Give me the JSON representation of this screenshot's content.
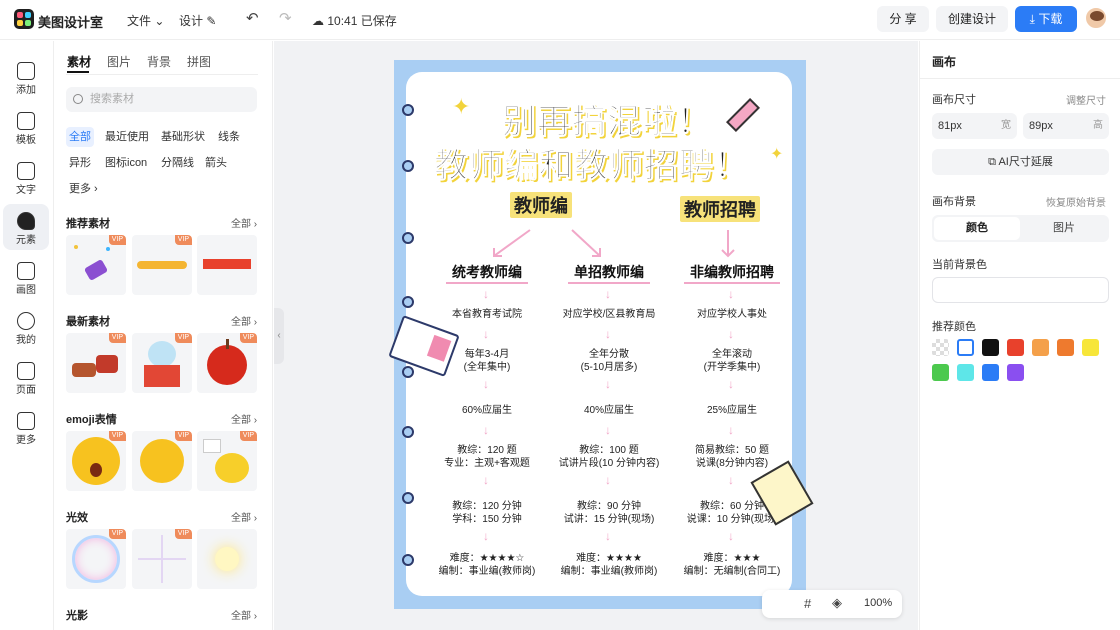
{
  "app": {
    "name": "美图设计室"
  },
  "topbar": {
    "file_menu": "文件",
    "design_menu": "设计",
    "save_status": "10:41 已保存",
    "share_label": "分 享",
    "create_label": "创建设计",
    "download_label": "下载"
  },
  "rail": [
    {
      "label": "添加",
      "icon": "plus-square-icon"
    },
    {
      "label": "模板",
      "icon": "template-icon"
    },
    {
      "label": "文字",
      "icon": "text-icon"
    },
    {
      "label": "元素",
      "icon": "shapes-icon",
      "active": true
    },
    {
      "label": "画图",
      "icon": "pencil-icon"
    },
    {
      "label": "我的",
      "icon": "user-icon"
    },
    {
      "label": "页面",
      "icon": "page-add-icon"
    },
    {
      "label": "更多",
      "icon": "cube-icon"
    }
  ],
  "panel": {
    "tabs": [
      "素材",
      "图片",
      "背景",
      "拼图"
    ],
    "search_placeholder": "搜索素材",
    "chips_row1": [
      "全部",
      "最近使用",
      "基础形状",
      "线条"
    ],
    "chips_row2": [
      "异形",
      "图标icon",
      "分隔线",
      "箭头"
    ],
    "more_label": "更多",
    "all_label": "全部",
    "vip_label": "VIP",
    "sections": [
      {
        "title": "推荐素材",
        "items": [
          "party-popper",
          "yellow-brush-stroke",
          "red-bar"
        ]
      },
      {
        "title": "最新素材",
        "items": [
          "reindeer-sleigh",
          "snow-globe-gift",
          "red-apple"
        ]
      },
      {
        "title": "emoji表情",
        "items": [
          "scared-face",
          "thinking-face",
          "chick-with-sign"
        ]
      },
      {
        "title": "光效",
        "items": [
          "rainbow-bubble",
          "sparkle-star",
          "glow"
        ]
      },
      {
        "title": "光影",
        "items": []
      }
    ]
  },
  "poster": {
    "title_line1": "别再搞混啦！",
    "title_line2": "教师编和教师招聘！",
    "tag_left": "教师编",
    "tag_right": "教师招聘",
    "columns": [
      {
        "head": "统考教师编",
        "rows": [
          "本省教育考试院",
          "每年3-4月\n(全年集中)",
          "60%应届生",
          "教综：120 题\n专业：主观+客观题",
          "教综：120 分钟\n学科：150 分钟",
          "难度：★★★★☆\n编制：事业编(教师岗)"
        ]
      },
      {
        "head": "单招教师编",
        "rows": [
          "对应学校/区县教育局",
          "全年分散\n(5-10月居多)",
          "40%应届生",
          "教综：100 题\n试讲片段(10 分钟内容)",
          "教综：90 分钟\n试讲：15 分钟(现场)",
          "难度：★★★★\n编制：事业编(教师岗)"
        ]
      },
      {
        "head": "非编教师招聘",
        "rows": [
          "对应学校人事处",
          "全年滚动\n(开学季集中)",
          "25%应届生",
          "简易教综：50 题\n说课(8分钟内容)",
          "教综：60 分钟\n说课：10 分钟(现场)",
          "难度：★★★\n编制：无编制(合同工)"
        ]
      }
    ]
  },
  "zoom": {
    "value": "100%"
  },
  "right": {
    "title": "画布",
    "size_label": "画布尺寸",
    "adjust_size": "调整尺寸",
    "width_value": "81px",
    "width_unit": "宽",
    "height_value": "89px",
    "height_unit": "高",
    "ai_extend": "AI尺寸延展",
    "bg_label": "画布背景",
    "restore_bg": "恢复原始背景",
    "seg_color": "颜色",
    "seg_image": "图片",
    "current_bg": "当前背景色",
    "recommended": "推荐颜色",
    "colors": [
      "transparent",
      "#ffffff",
      "#111111",
      "#e8412c",
      "#f4a04a",
      "#ee7a2e",
      "#f7e63a",
      "#4cc94e",
      "#5ee6e8",
      "#2b7cf6",
      "#8a4ff0"
    ]
  },
  "colors": {
    "accent": "#2b7cf6",
    "poster_bg": "#a9cef3",
    "highlight": "#f7e27a",
    "arrow_pink": "#f1a7c8"
  }
}
